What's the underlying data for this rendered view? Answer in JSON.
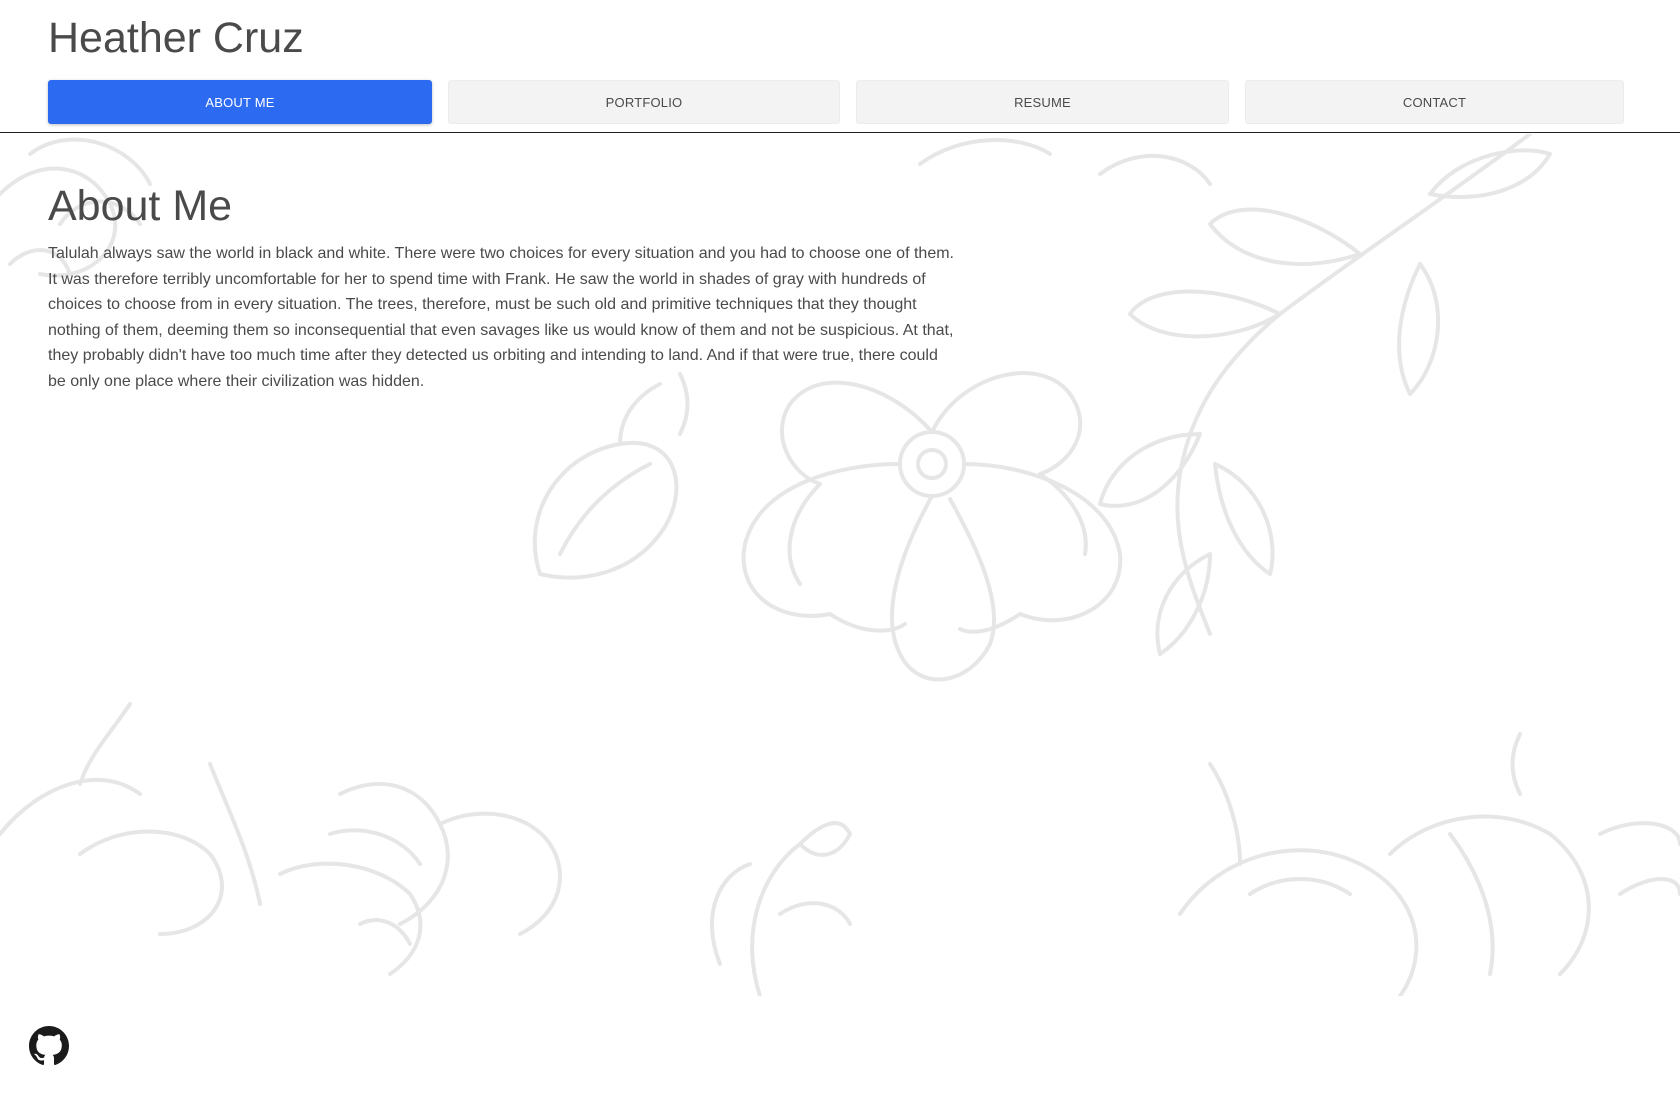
{
  "header": {
    "site_title": "Heather Cruz"
  },
  "nav": {
    "tabs": [
      {
        "label": "ABOUT ME",
        "active": true
      },
      {
        "label": "PORTFOLIO",
        "active": false
      },
      {
        "label": "RESUME",
        "active": false
      },
      {
        "label": "CONTACT",
        "active": false
      }
    ]
  },
  "about": {
    "title": "About Me",
    "paragraph": "Talulah always saw the world in black and white. There were two choices for every situation and you had to choose one of them. It was therefore terribly uncomfortable for her to spend time with Frank. He saw the world in shades of gray with hundreds of choices to choose from in every situation. The trees, therefore, must be such old and primitive techniques that they thought nothing of them, deeming them so inconsequential that even savages like us would know of them and not be suspicious. At that, they probably didn't have too much time after they detected us orbiting and intending to land. And if that were true, there could be only one place where their civilization was hidden."
  },
  "footer": {
    "icons": [
      "github-icon"
    ]
  },
  "colors": {
    "accent": "#2d6af2",
    "text": "#4a4a4a",
    "tab_bg": "#f3f3f3",
    "floral_line": "#e6e6e6"
  }
}
